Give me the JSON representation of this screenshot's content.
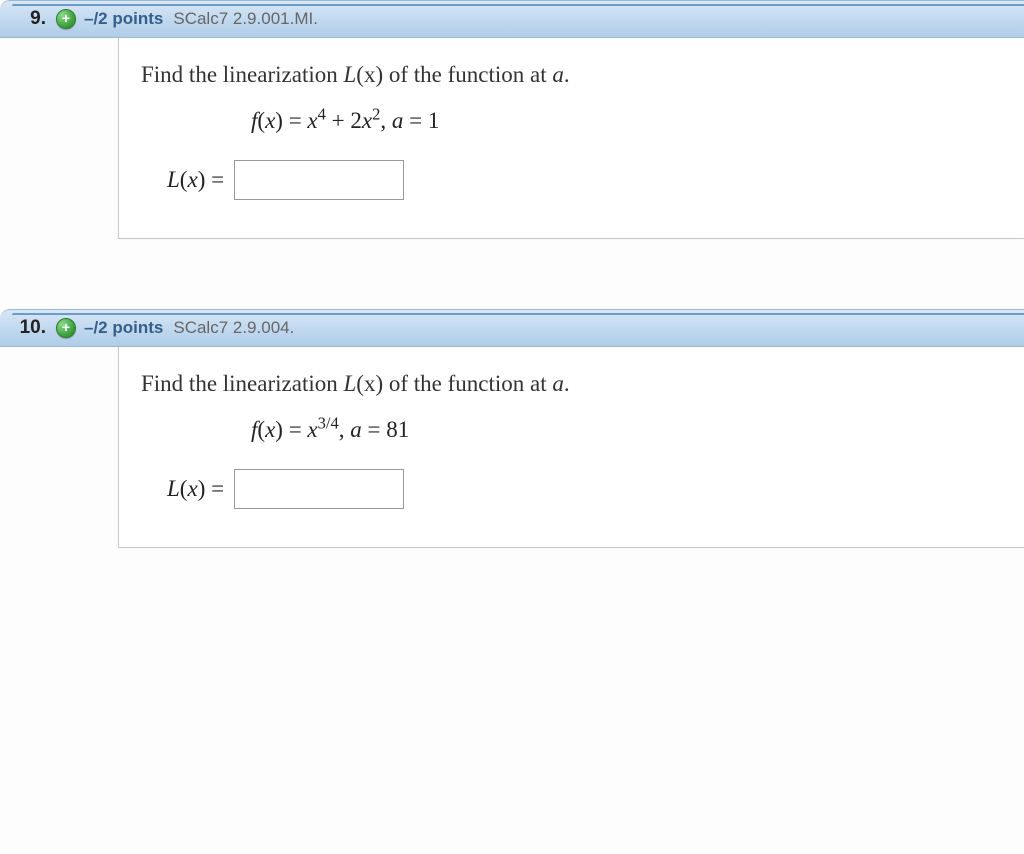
{
  "questions": [
    {
      "number": "9.",
      "points": "–/2 points",
      "problem_ref": "SCalc7 2.9.001.MI.",
      "prompt_prefix": "Find the linearization ",
      "prompt_Lx": "L",
      "prompt_mid": "(x) of the function at ",
      "prompt_a": "a",
      "prompt_suffix": ".",
      "equation": {
        "f_label": "f",
        "x_open": "(",
        "x_var": "x",
        "x_close_eq": ") = ",
        "term1_base": "x",
        "term1_exp": "4",
        "plus": " + 2",
        "term2_base": "x",
        "term2_exp": "2",
        "comma": ", ",
        "a_var": "a",
        "eq": " = ",
        "a_val": "1"
      },
      "answer_label_L": "L",
      "answer_label_open": "(",
      "answer_label_x": "x",
      "answer_label_close": ") =",
      "answer_value": ""
    },
    {
      "number": "10.",
      "points": "–/2 points",
      "problem_ref": "SCalc7 2.9.004.",
      "prompt_prefix": "Find the linearization ",
      "prompt_Lx": "L",
      "prompt_mid": "(x) of the function at ",
      "prompt_a": "a",
      "prompt_suffix": ".",
      "equation": {
        "f_label": "f",
        "x_open": "(",
        "x_var": "x",
        "x_close_eq": ") = ",
        "term1_base": "x",
        "term1_exp": "3/4",
        "plus": "",
        "term2_base": "",
        "term2_exp": "",
        "comma": ", ",
        "a_var": "a",
        "eq": " = ",
        "a_val": "81"
      },
      "answer_label_L": "L",
      "answer_label_open": "(",
      "answer_label_x": "x",
      "answer_label_close": ") =",
      "answer_value": ""
    }
  ],
  "icons": {
    "plus": "+"
  }
}
